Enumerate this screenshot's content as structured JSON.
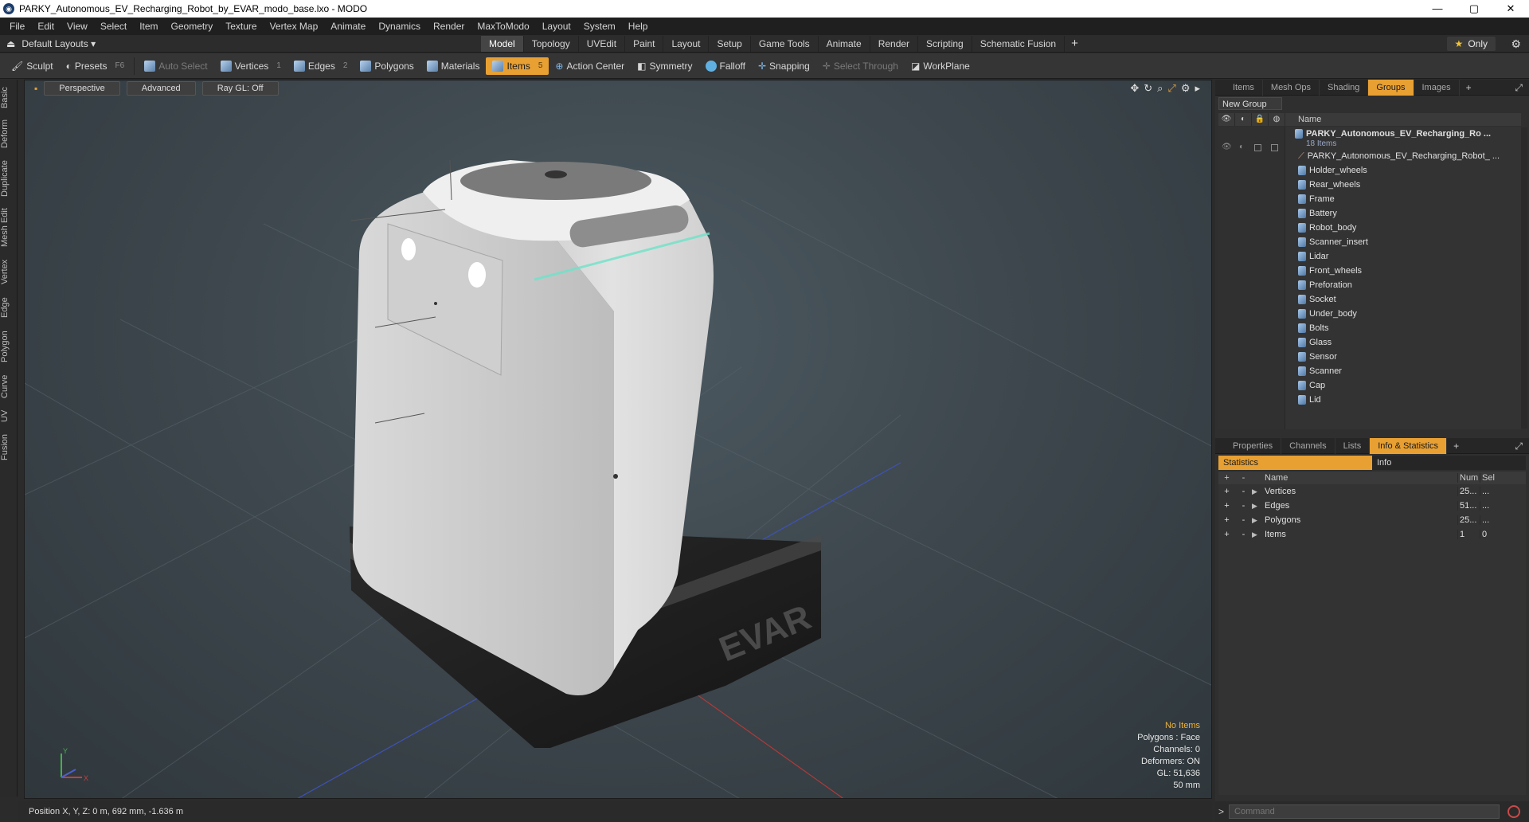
{
  "window": {
    "title": "PARKY_Autonomous_EV_Recharging_Robot_by_EVAR_modo_base.lxo - MODO",
    "minimize": "—",
    "maximize": "▢",
    "close": "✕"
  },
  "menu": [
    "File",
    "Edit",
    "View",
    "Select",
    "Item",
    "Geometry",
    "Texture",
    "Vertex Map",
    "Animate",
    "Dynamics",
    "Render",
    "MaxToModo",
    "Layout",
    "System",
    "Help"
  ],
  "layoutbar": {
    "layouts_label": "Default Layouts",
    "tabs": [
      "Model",
      "Topology",
      "UVEdit",
      "Paint",
      "Layout",
      "Setup",
      "Game Tools",
      "Animate",
      "Render",
      "Scripting",
      "Schematic Fusion"
    ],
    "active_tab": "Model",
    "only_label": "Only"
  },
  "toolbar": {
    "sculpt": "Sculpt",
    "presets": "Presets",
    "presets_key": "F6",
    "auto_select": "Auto Select",
    "vertices": "Vertices",
    "vertices_key": "1",
    "edges": "Edges",
    "edges_key": "2",
    "polygons": "Polygons",
    "materials": "Materials",
    "items": "Items",
    "items_key": "5",
    "action_center": "Action Center",
    "symmetry": "Symmetry",
    "falloff": "Falloff",
    "snapping": "Snapping",
    "select_through": "Select Through",
    "workplane": "WorkPlane"
  },
  "left_tabs": [
    "Basic",
    "Deform",
    "Duplicate",
    "Mesh Edit",
    "Vertex",
    "Edge",
    "Polygon",
    "Curve",
    "UV",
    "Fusion"
  ],
  "viewport": {
    "perspective": "Perspective",
    "advanced": "Advanced",
    "raygl": "Ray GL: Off",
    "brand_text": "EVAR",
    "hud": {
      "items": "No Items",
      "polygons": "Polygons : Face",
      "channels": "Channels: 0",
      "deformers": "Deformers: ON",
      "gl": "GL: 51,636",
      "scale": "50 mm"
    },
    "axis_y": "Y",
    "axis_x": "X"
  },
  "groups_panel": {
    "tabs": [
      "Items",
      "Mesh Ops",
      "Shading",
      "Groups",
      "Images"
    ],
    "active": "Groups",
    "new_group": "New Group",
    "name_header": "Name",
    "root": "PARKY_Autonomous_EV_Recharging_Ro ...",
    "root_count": "18 Items",
    "children": [
      "PARKY_Autonomous_EV_Recharging_Robot_ ...",
      "Holder_wheels",
      "Rear_wheels",
      "Frame",
      "Battery",
      "Robot_body",
      "Scanner_insert",
      "Lidar",
      "Front_wheels",
      "Preforation",
      "Socket",
      "Under_body",
      "Bolts",
      "Glass",
      "Sensor",
      "Scanner",
      "Cap",
      "Lid"
    ]
  },
  "stats_panel": {
    "tabs": [
      "Properties",
      "Channels",
      "Lists",
      "Info & Statistics"
    ],
    "active": "Info & Statistics",
    "subtabs": [
      "Statistics",
      "Info"
    ],
    "headers": {
      "name": "Name",
      "num": "Num",
      "sel": "Sel"
    },
    "rows": [
      {
        "name": "Vertices",
        "num": "25...",
        "sel": "..."
      },
      {
        "name": "Edges",
        "num": "51...",
        "sel": "..."
      },
      {
        "name": "Polygons",
        "num": "25...",
        "sel": "..."
      },
      {
        "name": "Items",
        "num": "1",
        "sel": "0"
      }
    ]
  },
  "status": {
    "position": "Position X, Y, Z:  0 m, 692 mm, -1.636 m"
  },
  "command": {
    "placeholder": "Command"
  },
  "colors": {
    "accent": "#e8a032",
    "warn": "#f0b43a"
  }
}
